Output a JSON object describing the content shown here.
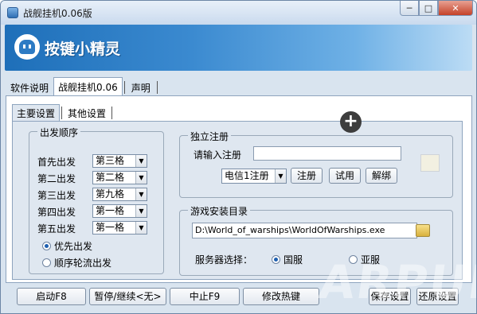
{
  "window": {
    "title": "战舰挂机0.06版",
    "min_label": "─",
    "max_label": "□",
    "close_label": "✕"
  },
  "banner": {
    "brand": "按键小精灵"
  },
  "tabs1": [
    "软件说明",
    "战舰挂机0.06",
    "声明"
  ],
  "tabs2": [
    "主要设置",
    "其他设置"
  ],
  "departure": {
    "title": "出发顺序",
    "rows": [
      {
        "label": "首先出发",
        "value": "第三格"
      },
      {
        "label": "第二出发",
        "value": "第二格"
      },
      {
        "label": "第三出发",
        "value": "第九格"
      },
      {
        "label": "第四出发",
        "value": "第一格"
      },
      {
        "label": "第五出发",
        "value": "第一格"
      }
    ],
    "radio_priority": "优先出发",
    "radio_rotation": "顺序轮流出发"
  },
  "register": {
    "title": "独立注册",
    "input_label": "请输入注册",
    "input_value": "",
    "carrier": "电信1注册",
    "btn_register": "注册",
    "btn_trial": "试用",
    "btn_unbind": "解绑"
  },
  "install": {
    "title": "游戏安装目录",
    "path": "D:\\World_of_warships\\WorldOfWarships.exe",
    "server_label": "服务器选择：",
    "server_cn": "国服",
    "server_asia": "亚服"
  },
  "bottom": {
    "start": "启动F8",
    "pause": "暂停/继续<无>",
    "stop": "中止F9",
    "hotkey": "修改热键",
    "save": "保存设置",
    "restore": "还原设置"
  },
  "overlay": {
    "plus": "+",
    "watermark": "ARPUN"
  }
}
